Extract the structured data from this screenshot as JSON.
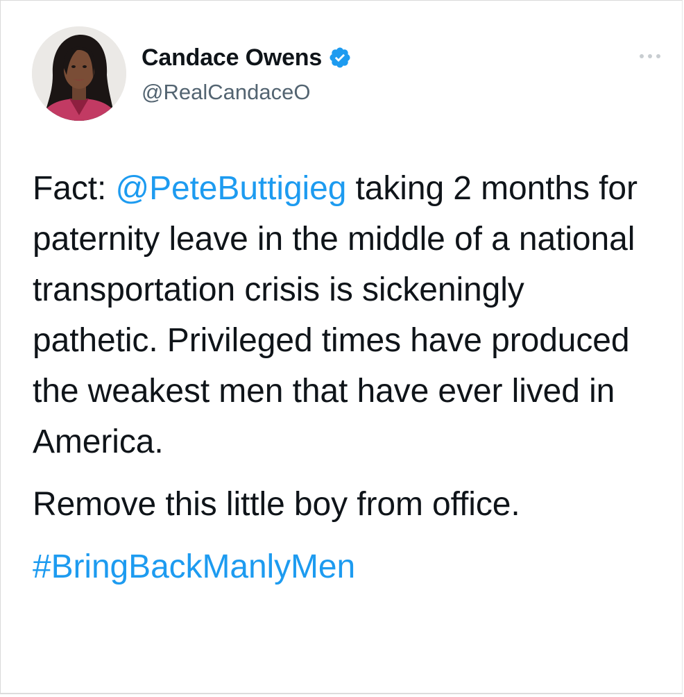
{
  "tweet": {
    "author": {
      "display_name": "Candace Owens",
      "handle": "@RealCandaceO",
      "verified_icon": "verified-badge-icon",
      "verified_color": "#1d9bf0",
      "avatar_icon": "profile-photo"
    },
    "more_icon": "more-options-icon",
    "body": {
      "line1_prefix": "Fact: ",
      "mention": "@PeteButtigieg",
      "line1_suffix": " taking 2",
      "rest_of_paragraph": "months for paternity leave in the middle of a national transportation crisis is sickeningly pathetic. Privileged times have produced the weakest men that have ever lived in America.",
      "paragraph2": "Remove this little boy from office.",
      "hashtag": "#BringBackManlyMen"
    },
    "colors": {
      "link": "#1d9bf0",
      "text": "#0f1419",
      "secondary": "#536471"
    }
  }
}
